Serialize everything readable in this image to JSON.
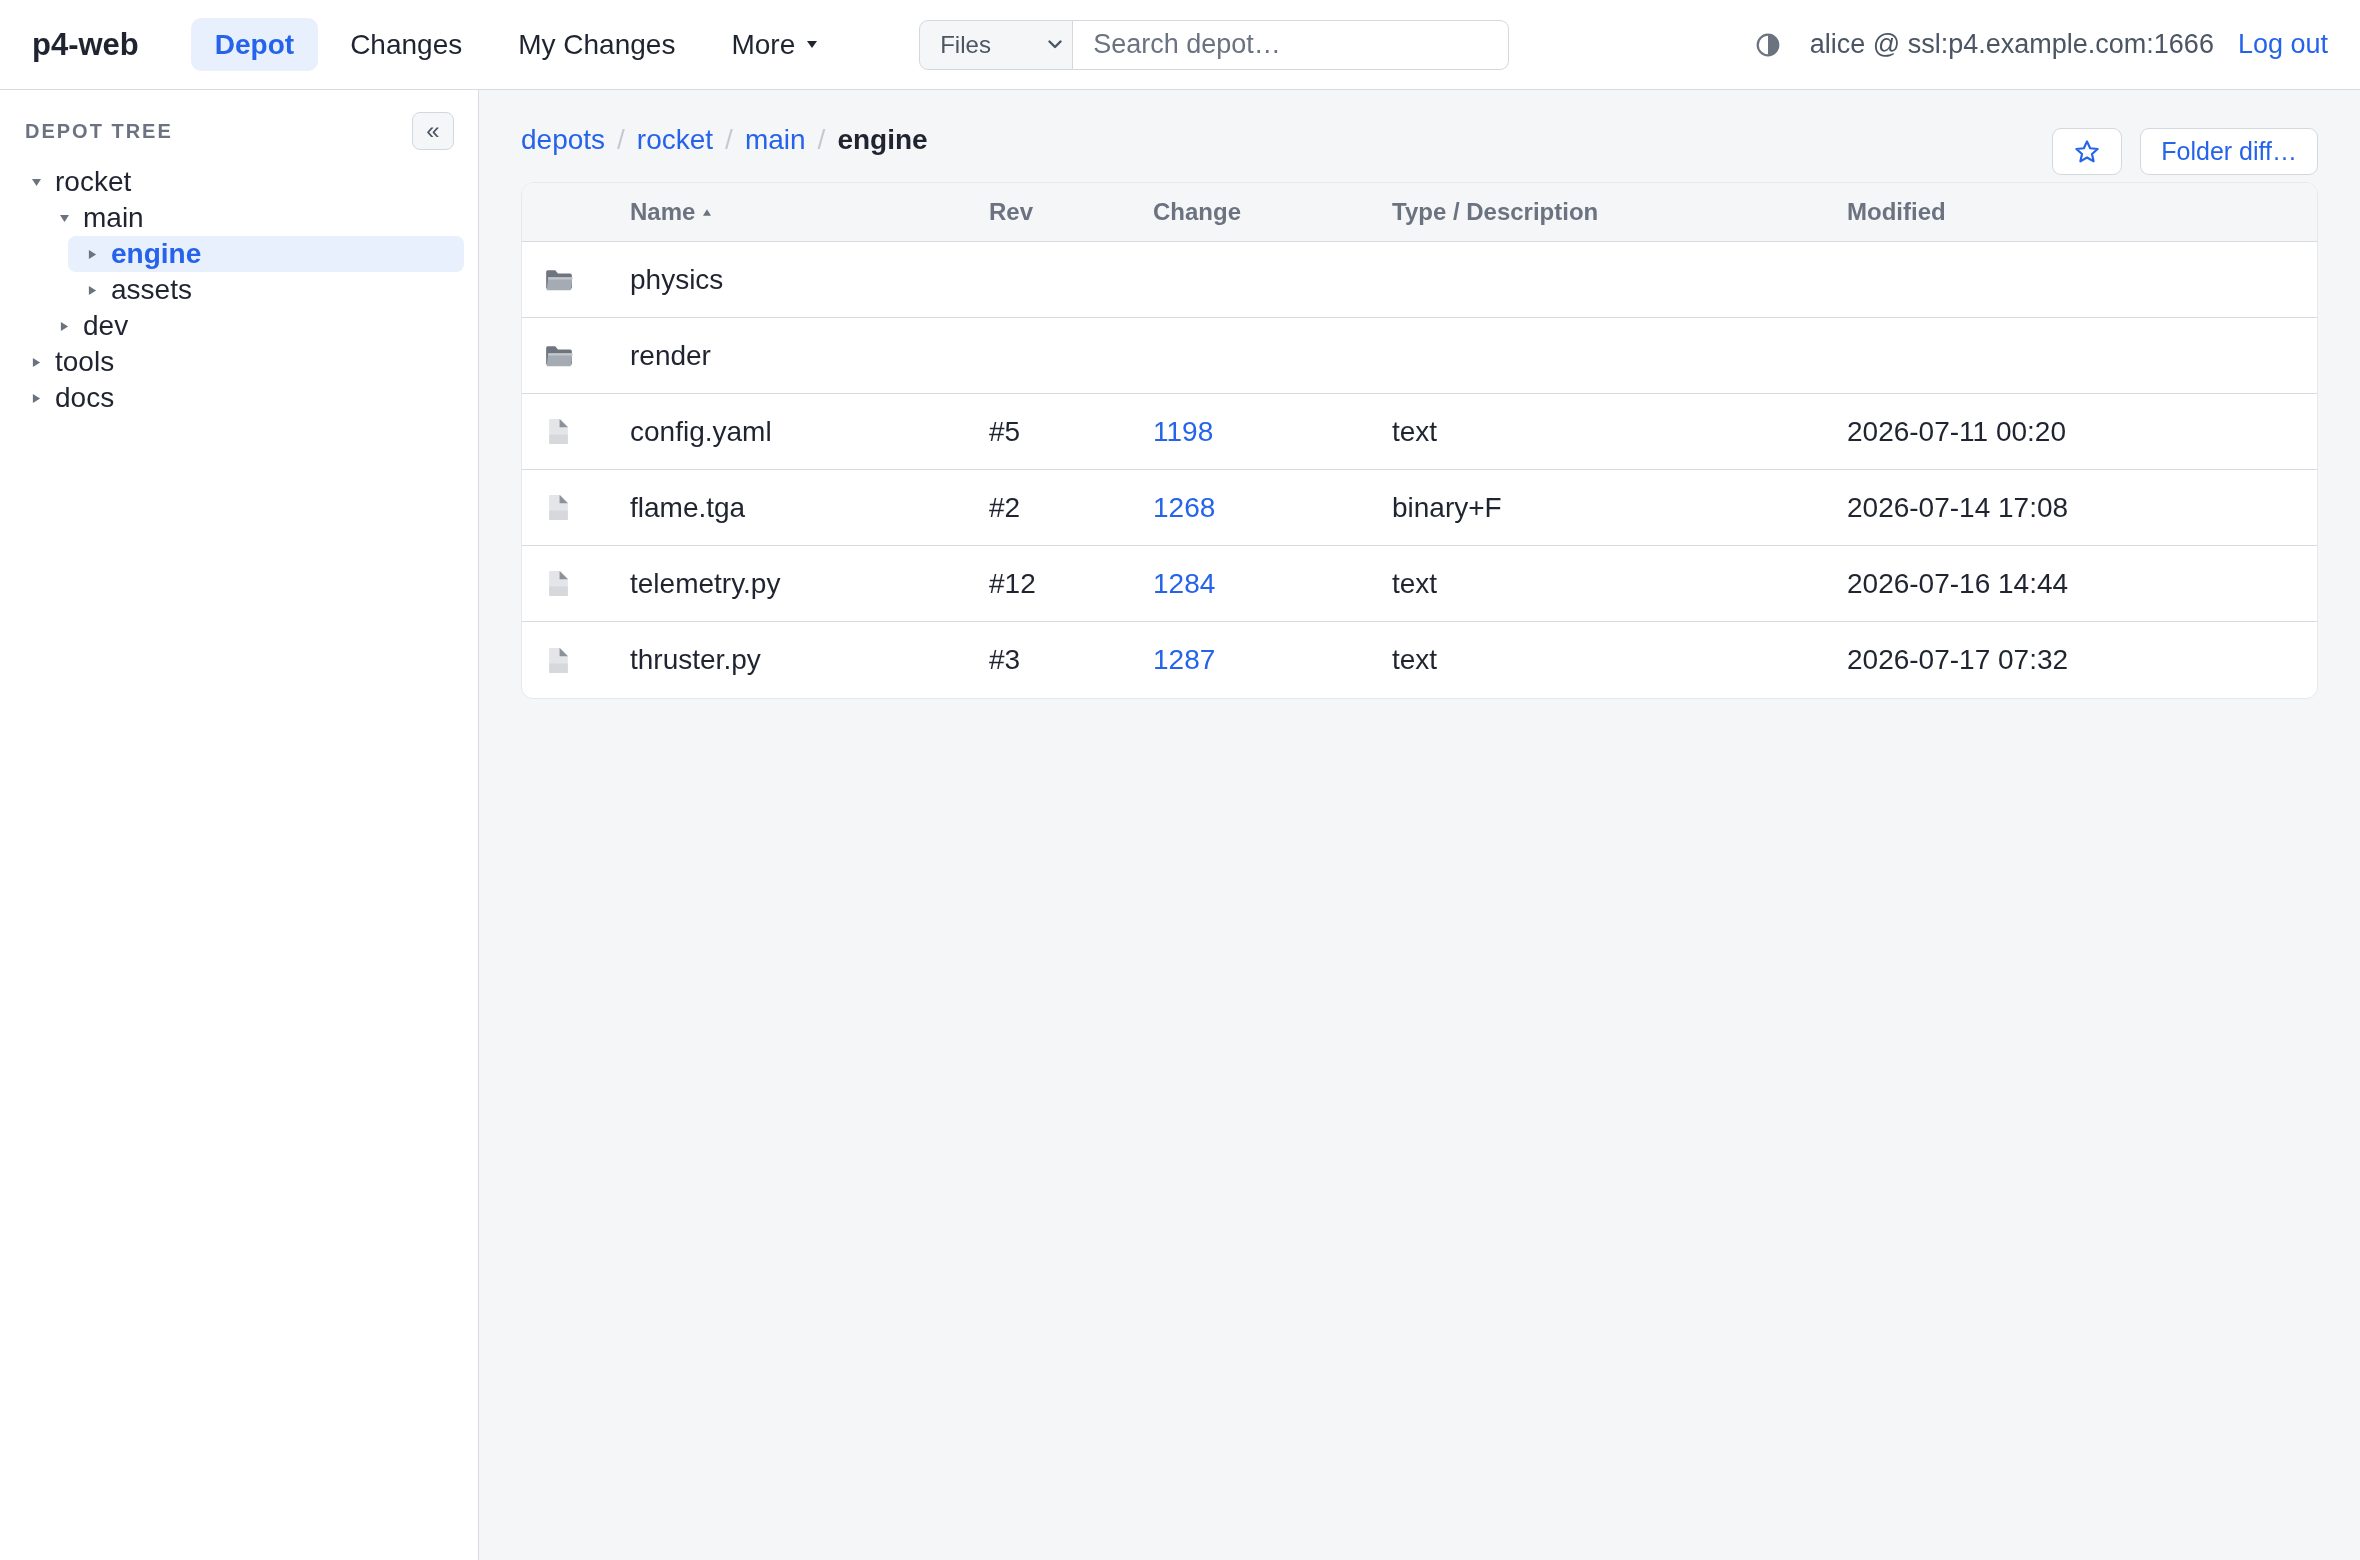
{
  "app": {
    "logo": "p4-web"
  },
  "nav": [
    {
      "label": "Depot",
      "kind": "tab",
      "selected": true
    },
    {
      "label": "Changes",
      "kind": "tab",
      "selected": false
    },
    {
      "label": "My Changes",
      "kind": "tab",
      "selected": false
    },
    {
      "label": "More",
      "kind": "menu",
      "selected": false
    }
  ],
  "search": {
    "scope": "Files",
    "placeholder": "Search depot…"
  },
  "user": {
    "connection": "alice @ ssl:p4.example.com:1666",
    "logout": "Log out"
  },
  "sidebar": {
    "title": "DEPOT TREE",
    "collapse_button": "«",
    "tree": [
      {
        "label": "rocket",
        "expanded": true,
        "selected": false,
        "children": [
          {
            "label": "main",
            "expanded": true,
            "selected": false,
            "children": [
              {
                "label": "engine",
                "expanded": false,
                "selected": true
              },
              {
                "label": "assets",
                "expanded": false,
                "selected": false
              }
            ]
          },
          {
            "label": "dev",
            "expanded": false,
            "selected": false
          }
        ]
      },
      {
        "label": "tools",
        "expanded": false,
        "selected": false
      },
      {
        "label": "docs",
        "expanded": false,
        "selected": false
      }
    ]
  },
  "breadcrumb": {
    "separator": "/",
    "items": [
      {
        "label": "depots",
        "current": false
      },
      {
        "label": "rocket",
        "current": false
      },
      {
        "label": "main",
        "current": false
      },
      {
        "label": "engine",
        "current": true
      }
    ]
  },
  "actions": {
    "starred": false,
    "folder_diff": "Folder diff…"
  },
  "table": {
    "columns": [
      {
        "label": "Name",
        "sorted": true
      },
      {
        "label": "Rev",
        "sorted": false
      },
      {
        "label": "Change",
        "sorted": false
      },
      {
        "label": "Type / Description",
        "sorted": false
      },
      {
        "label": "Modified",
        "sorted": false
      }
    ],
    "rows": [
      {
        "kind": "folder",
        "name": "physics"
      },
      {
        "kind": "folder",
        "name": "render"
      },
      {
        "kind": "file",
        "name": "config.yaml",
        "rev": "#5",
        "change": "1198",
        "type": "text",
        "modified": "2026-07-11 00:20"
      },
      {
        "kind": "file",
        "name": "flame.tga",
        "rev": "#2",
        "change": "1268",
        "type": "binary+F",
        "modified": "2026-07-14 17:08"
      },
      {
        "kind": "file",
        "name": "telemetry.py",
        "rev": "#12",
        "change": "1284",
        "type": "text",
        "modified": "2026-07-16 14:44"
      },
      {
        "kind": "file",
        "name": "thruster.py",
        "rev": "#3",
        "change": "1287",
        "type": "text",
        "modified": "2026-07-17 07:32"
      }
    ]
  }
}
